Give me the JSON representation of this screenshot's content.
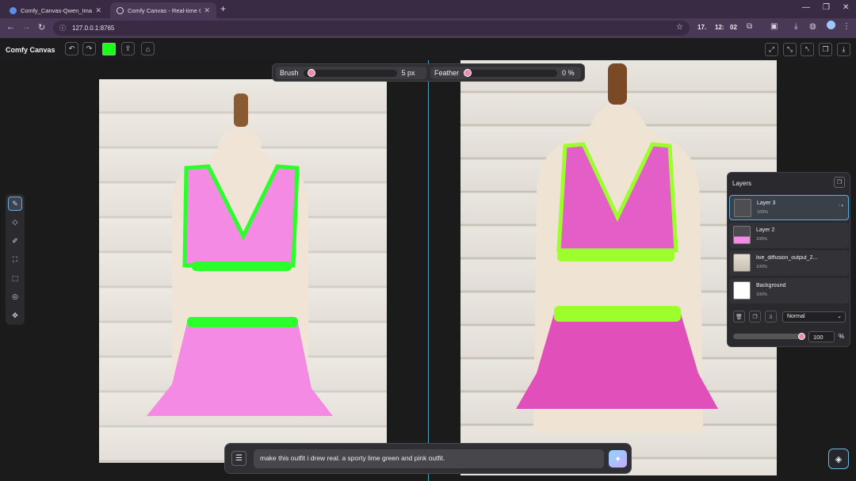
{
  "browser": {
    "tabs": [
      {
        "title": "Comfy_Canvas-Qwen_Image_Ed",
        "close": "✕",
        "icon": "comfy-icon"
      },
      {
        "title": "Comfy Canvas - Real-time Canv",
        "close": "✕",
        "icon": "globe-icon"
      }
    ],
    "new_tab": "+",
    "window_controls": {
      "minimize": "—",
      "maximize": "❐",
      "close": "✕"
    },
    "url": "127.0.0.1:8765",
    "extensions": {
      "a": "17.",
      "b": "12:",
      "c": "02"
    }
  },
  "app": {
    "title": "Comfy Canvas",
    "toolbar_icons": [
      "undo-icon",
      "redo-icon",
      "color-swatch",
      "export-icon",
      "clear-icon"
    ],
    "color": "#19ff19",
    "right_icons": [
      "fit-icon",
      "zoom-icon",
      "crop-icon",
      "copy-icon",
      "download-icon"
    ]
  },
  "brush_controls": {
    "brush_label": "Brush",
    "brush_value": "5",
    "brush_unit": "px",
    "brush_level": 0.05,
    "feather_label": "Feather",
    "feather_value": "0",
    "feather_unit": "%",
    "feather_level": 0
  },
  "tools": [
    "brush-icon",
    "eraser-icon",
    "eyedropper-icon",
    "fill-icon",
    "select-icon",
    "lasso-icon",
    "transform-icon"
  ],
  "layers_panel": {
    "title": "Layers",
    "layers": [
      {
        "name": "Layer 3",
        "opacity": "100%",
        "selected": true
      },
      {
        "name": "Layer 2",
        "opacity": "100%",
        "selected": false
      },
      {
        "name": "live_diffusion_output_2...",
        "opacity": "100%",
        "selected": false
      },
      {
        "name": "Background",
        "opacity": "100%",
        "selected": false
      }
    ],
    "blend_mode": "Normal",
    "opacity_value": "100",
    "opacity_unit": "%",
    "opacity_level": 1.0
  },
  "prompt": {
    "text": "make this outfit i drew real. a sporty lime green and pink outfit.",
    "generate_icon": "sparkle-icon",
    "menu_icon": "menu-icon"
  }
}
